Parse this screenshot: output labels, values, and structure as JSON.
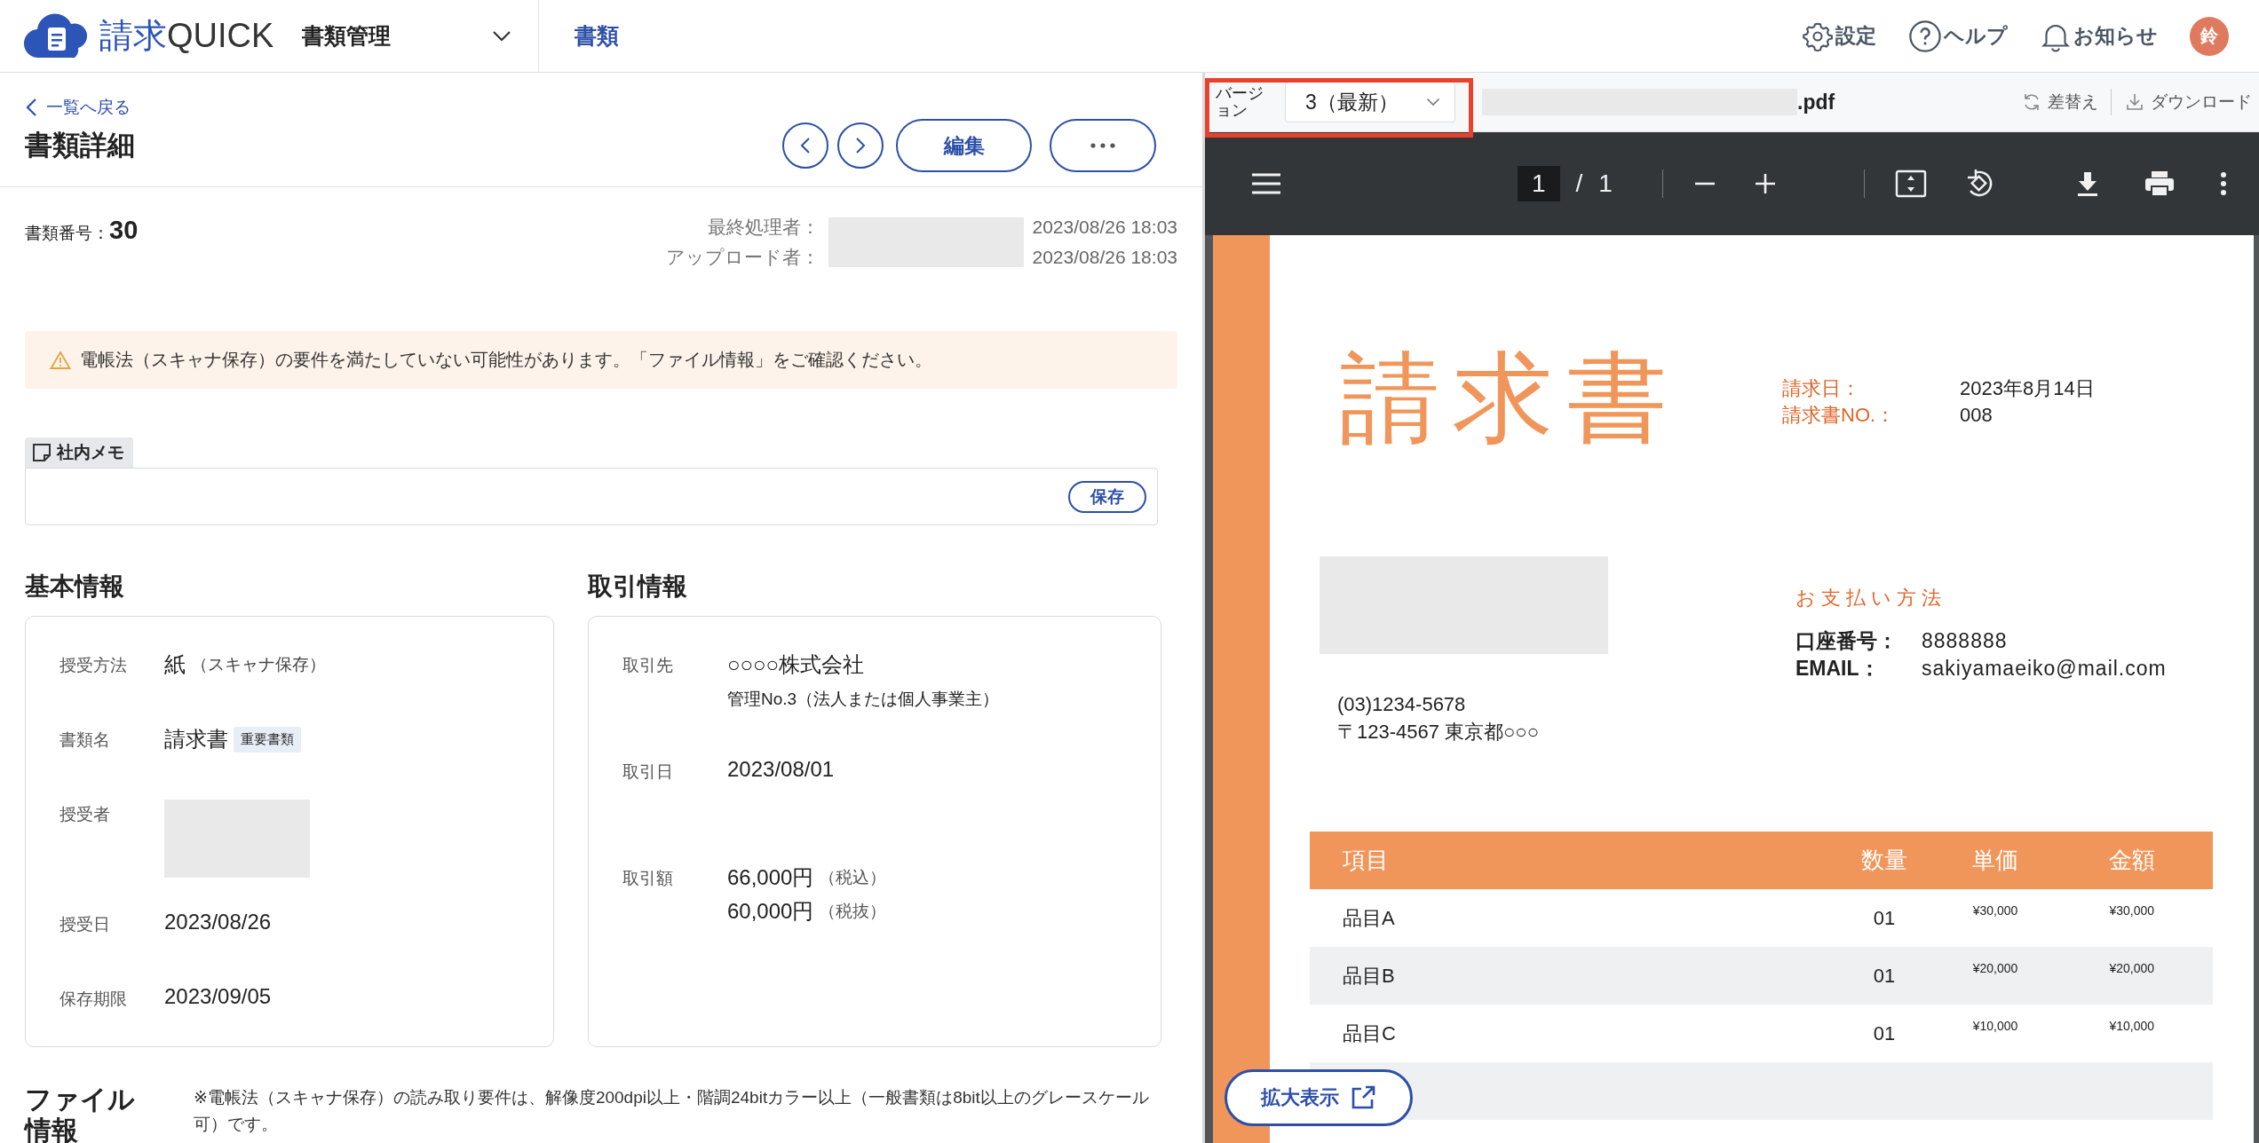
{
  "header": {
    "logo": {
      "brand": "請求",
      "suffix": "QUICK"
    },
    "module": "書類管理",
    "nav": [
      {
        "label": "書類",
        "selected": true
      }
    ],
    "actions": [
      {
        "kind": "settings",
        "label": "設定"
      },
      {
        "kind": "help",
        "label": "ヘルプ"
      },
      {
        "kind": "notifications",
        "label": "お知らせ"
      }
    ],
    "avatar": "鈴"
  },
  "detail": {
    "back_link": "一覧へ戻る",
    "title": "書類詳細",
    "edit_button": "編集",
    "doc_number_label": "書類番号：",
    "doc_number": "30",
    "meta": [
      {
        "label": "最終処理者：",
        "datetime": "2023/08/26 18:03"
      },
      {
        "label": "アップロード者：",
        "datetime": "2023/08/26 18:03"
      }
    ],
    "warning": "電帳法（スキャナ保存）の要件を満たしていない可能性があります。「ファイル情報」をご確認ください。",
    "memo": {
      "tab": "社内メモ",
      "save_button": "保存"
    },
    "sections": [
      {
        "heading": "基本情報",
        "fields": [
          {
            "kind": "text",
            "label": "授受方法",
            "value": "紙",
            "note": "（スキャナ保存）"
          },
          {
            "kind": "tagged",
            "label": "書類名",
            "value": "請求書",
            "tag": "重要書類"
          },
          {
            "kind": "redacted",
            "label": "授受者"
          },
          {
            "kind": "text",
            "label": "授受日",
            "value": "2023/08/26"
          },
          {
            "kind": "text",
            "label": "保存期限",
            "value": "2023/09/05"
          }
        ]
      },
      {
        "heading": "取引情報",
        "fields": [
          {
            "kind": "text",
            "label": "取引先",
            "value": "○○○○株式会社",
            "sub": "管理No.3（法人または個人事業主）"
          },
          {
            "kind": "text",
            "label": "取引日",
            "value": "2023/08/01"
          },
          {
            "kind": "lines",
            "label": "取引額",
            "lines": [
              {
                "value": "66,000円",
                "note": "（税込）"
              },
              {
                "value": "60,000円",
                "note": "（税抜）"
              }
            ]
          }
        ]
      }
    ],
    "file_info": {
      "heading": "ファイル情報",
      "note": "※電帳法（スキャナ保存）の読み取り要件は、解像度200dpi以上・階調24bitカラー以上（一般書類は8bit以上のグレースケール可）です。"
    }
  },
  "viewer": {
    "version_label": "バージョン",
    "version": "3（最新）",
    "highlighted": true,
    "file_name": ".pdf",
    "actions": [
      {
        "kind": "replace",
        "label": "差替え"
      },
      {
        "kind": "download",
        "label": "ダウンロード"
      }
    ],
    "toolbar": {
      "page_current": "1",
      "page_separator": "/",
      "page_total": "1"
    },
    "invoice": {
      "title": "請求書",
      "meta": [
        {
          "label": "請求日：",
          "value": "2023年8月14日"
        },
        {
          "label": "請求書NO.：",
          "value": "008"
        }
      ],
      "phone": "(03)1234-5678",
      "address": "〒123-4567 東京都○○○",
      "payment_heading": "お支払い方法",
      "payment": [
        {
          "label": "口座番号：",
          "value": "8888888"
        },
        {
          "label": "EMAIL：",
          "value": "sakiyamaeiko@mail.com"
        }
      ],
      "columns": [
        "項目",
        "数量",
        "単価",
        "金額"
      ],
      "rows": [
        {
          "item": "品目A",
          "qty": "01",
          "unit": "¥30,000",
          "amount": "¥30,000"
        },
        {
          "item": "品目B",
          "qty": "01",
          "unit": "¥20,000",
          "amount": "¥20,000"
        },
        {
          "item": "品目C",
          "qty": "01",
          "unit": "¥10,000",
          "amount": "¥10,000"
        }
      ]
    },
    "expand_button": "拡大表示"
  }
}
